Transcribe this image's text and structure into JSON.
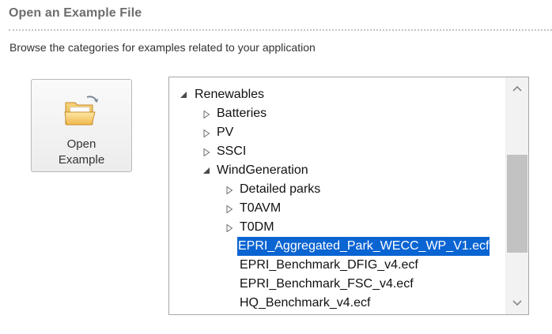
{
  "header": {
    "title": "Open an Example File",
    "description": "Browse the categories for examples related to your application"
  },
  "open_button": {
    "label_line1": "Open",
    "label_line2": "Example",
    "icon": "folder-open-icon"
  },
  "tree": {
    "rows": [
      {
        "label": "Renewables",
        "expander": "expanded",
        "level": 0
      },
      {
        "label": "Batteries",
        "expander": "collapsed",
        "level": 1
      },
      {
        "label": "PV",
        "expander": "collapsed",
        "level": 1
      },
      {
        "label": "SSCI",
        "expander": "collapsed",
        "level": 1
      },
      {
        "label": "WindGeneration",
        "expander": "expanded",
        "level": 1
      },
      {
        "label": "Detailed parks",
        "expander": "collapsed",
        "level": 2
      },
      {
        "label": "T0AVM",
        "expander": "collapsed",
        "level": 2
      },
      {
        "label": "T0DM",
        "expander": "collapsed",
        "level": 2
      },
      {
        "label": "EPRI_Aggregated_Park_WECC_WP_V1.ecf",
        "expander": "none",
        "level": 2,
        "selected": true
      },
      {
        "label": "EPRI_Benchmark_DFIG_v4.ecf",
        "expander": "none",
        "level": 2
      },
      {
        "label": "EPRI_Benchmark_FSC_v4.ecf",
        "expander": "none",
        "level": 2
      },
      {
        "label": "HQ_Benchmark_v4.ecf",
        "expander": "none",
        "level": 2
      }
    ],
    "selection_color": "#0a64d2"
  },
  "scrollbar": {
    "up_icon": "chevron-up-icon",
    "down_icon": "chevron-down-icon",
    "position": 0.42
  }
}
